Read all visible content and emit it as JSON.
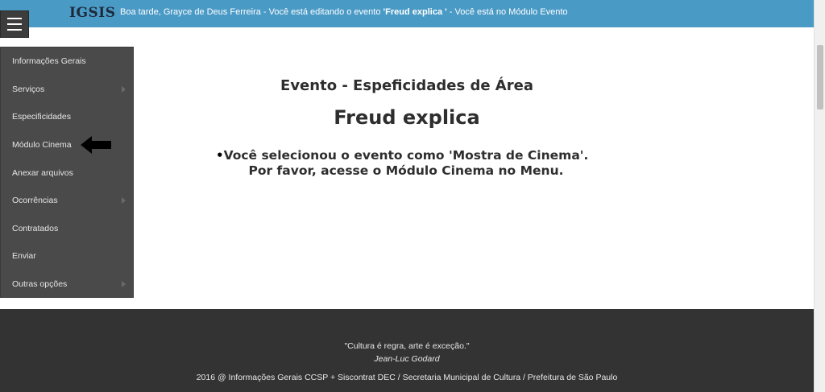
{
  "header": {
    "logo": "IGSIS",
    "greeting_prefix": "Boa tarde, Grayce de Deus Ferreira - Você está editando o evento ",
    "greeting_event": "'Freud explica '",
    "greeting_suffix": " - Você está no Módulo Evento"
  },
  "sidebar": {
    "items": [
      {
        "label": "Informações Gerais",
        "submenu": false
      },
      {
        "label": "Serviços",
        "submenu": true
      },
      {
        "label": "Especificidades",
        "submenu": false
      },
      {
        "label": "Módulo Cinema",
        "submenu": false
      },
      {
        "label": "Anexar arquivos",
        "submenu": false
      },
      {
        "label": "Ocorrências",
        "submenu": true
      },
      {
        "label": "Contratados",
        "submenu": false
      },
      {
        "label": "Enviar",
        "submenu": false
      },
      {
        "label": "Outras opções",
        "submenu": true
      }
    ]
  },
  "main": {
    "title": "Evento - Espeficidades de Área",
    "event_name": "Freud explica",
    "notice": "Você selecionou o evento como 'Mostra de Cinema'. Por favor, acesse o Módulo Cinema no Menu."
  },
  "footer": {
    "quote": "\"Cultura é regra, arte é exceção.\"",
    "author": "Jean-Luc Godard",
    "copyright": "2016 @ Informações Gerais CCSP + Siscontrat DEC / Secretaria Municipal de Cultura / Prefeitura de São Paulo"
  },
  "colors": {
    "topbar": "#4a9ac6",
    "sidebar": "#4a4a4a",
    "footer": "#333333"
  }
}
